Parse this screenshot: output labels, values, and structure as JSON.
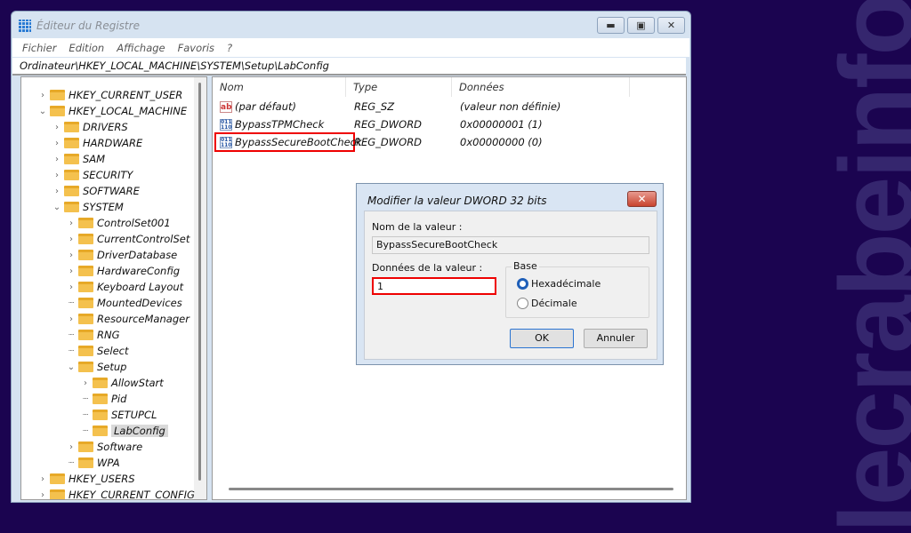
{
  "watermark": "lecrabeinfo",
  "window": {
    "title": "Éditeur du Registre",
    "controls": [
      "minimize",
      "maximize",
      "close"
    ]
  },
  "menu": [
    "Fichier",
    "Edition",
    "Affichage",
    "Favoris",
    "?"
  ],
  "address": "Ordinateur\\HKEY_LOCAL_MACHINE\\SYSTEM\\Setup\\LabConfig",
  "tree": [
    {
      "label": "HKEY_CURRENT_USER",
      "level": 0,
      "expander": "collapsed"
    },
    {
      "label": "HKEY_LOCAL_MACHINE",
      "level": 0,
      "expander": "expanded"
    },
    {
      "label": "DRIVERS",
      "level": 1,
      "expander": "collapsed"
    },
    {
      "label": "HARDWARE",
      "level": 1,
      "expander": "collapsed"
    },
    {
      "label": "SAM",
      "level": 1,
      "expander": "collapsed"
    },
    {
      "label": "SECURITY",
      "level": 1,
      "expander": "collapsed"
    },
    {
      "label": "SOFTWARE",
      "level": 1,
      "expander": "collapsed"
    },
    {
      "label": "SYSTEM",
      "level": 1,
      "expander": "expanded"
    },
    {
      "label": "ControlSet001",
      "level": 2,
      "expander": "collapsed"
    },
    {
      "label": "CurrentControlSet",
      "level": 2,
      "expander": "collapsed"
    },
    {
      "label": "DriverDatabase",
      "level": 2,
      "expander": "collapsed"
    },
    {
      "label": "HardwareConfig",
      "level": 2,
      "expander": "collapsed"
    },
    {
      "label": "Keyboard Layout",
      "level": 2,
      "expander": "collapsed"
    },
    {
      "label": "MountedDevices",
      "level": 2,
      "expander": "none"
    },
    {
      "label": "ResourceManager",
      "level": 2,
      "expander": "collapsed"
    },
    {
      "label": "RNG",
      "level": 2,
      "expander": "none"
    },
    {
      "label": "Select",
      "level": 2,
      "expander": "none"
    },
    {
      "label": "Setup",
      "level": 2,
      "expander": "expanded"
    },
    {
      "label": "AllowStart",
      "level": 3,
      "expander": "collapsed"
    },
    {
      "label": "Pid",
      "level": 3,
      "expander": "none"
    },
    {
      "label": "SETUPCL",
      "level": 3,
      "expander": "none"
    },
    {
      "label": "LabConfig",
      "level": 3,
      "expander": "none",
      "selected": true
    },
    {
      "label": "Software",
      "level": 2,
      "expander": "collapsed"
    },
    {
      "label": "WPA",
      "level": 2,
      "expander": "none"
    },
    {
      "label": "HKEY_USERS",
      "level": 0,
      "expander": "collapsed"
    },
    {
      "label": "HKEY_CURRENT_CONFIG",
      "level": 0,
      "expander": "collapsed"
    }
  ],
  "list": {
    "headers": [
      "Nom",
      "Type",
      "Données"
    ],
    "rows": [
      {
        "icon": "string-value-icon",
        "name": "(par défaut)",
        "type": "REG_SZ",
        "data": "(valeur non définie)"
      },
      {
        "icon": "binary-value-icon",
        "name": "BypassTPMCheck",
        "type": "REG_DWORD",
        "data": "0x00000001 (1)"
      },
      {
        "icon": "binary-value-icon",
        "name": "BypassSecureBootCheck",
        "type": "REG_DWORD",
        "data": "0x00000000 (0)",
        "highlighted": true
      }
    ]
  },
  "dialog": {
    "title": "Modifier la valeur DWORD 32 bits",
    "name_label": "Nom de la valeur :",
    "name_value": "BypassSecureBootCheck",
    "data_label": "Données de la valeur :",
    "data_value": "1",
    "base_label": "Base",
    "base_options": [
      "Hexadécimale",
      "Décimale"
    ],
    "base_selected": "Hexadécimale",
    "ok": "OK",
    "cancel": "Annuler"
  },
  "colors": {
    "background": "#1b0450",
    "highlight": "#e00000",
    "selected_radio": "#1f5fb8"
  }
}
